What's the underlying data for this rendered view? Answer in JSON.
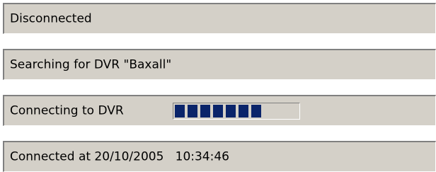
{
  "status_bars": [
    {
      "text": "Disconnected"
    },
    {
      "text": "Searching for DVR \"Baxall\""
    },
    {
      "text": "Connecting to DVR",
      "progress": 0.72
    },
    {
      "text": "Connected at 20/10/2005   10:34:46"
    }
  ],
  "colors": {
    "panel_bg": "#d4d0c8",
    "progress_chunk": "#0a246a"
  }
}
